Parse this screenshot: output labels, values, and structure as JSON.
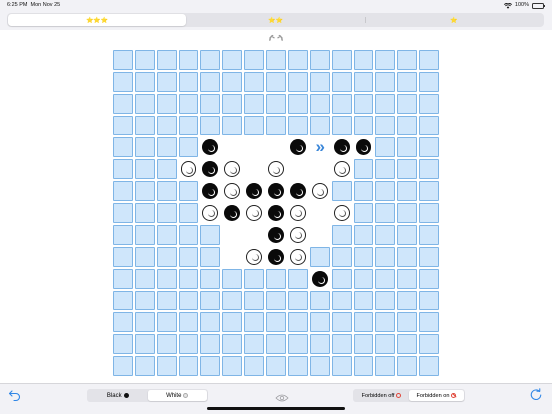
{
  "status_bar": {
    "time": "6:25 PM",
    "date": "Mon Nov 25",
    "battery": "100%",
    "icons": [
      "wifi-icon",
      "battery-icon"
    ]
  },
  "tabs": [
    {
      "label": "⭐⭐⭐",
      "active": true
    },
    {
      "label": "⭐⭐",
      "active": false
    },
    {
      "label": "⭐",
      "active": false
    }
  ],
  "laurel": "🕊🕊",
  "board": {
    "size": 15,
    "stones": [
      {
        "row": 4,
        "col": 4,
        "color": "black"
      },
      {
        "row": 4,
        "col": 8,
        "color": "black"
      },
      {
        "row": 4,
        "col": 10,
        "color": "black"
      },
      {
        "row": 4,
        "col": 11,
        "color": "black"
      },
      {
        "row": 5,
        "col": 3,
        "color": "white"
      },
      {
        "row": 5,
        "col": 4,
        "color": "black"
      },
      {
        "row": 5,
        "col": 5,
        "color": "white"
      },
      {
        "row": 5,
        "col": 7,
        "color": "white"
      },
      {
        "row": 5,
        "col": 10,
        "color": "white"
      },
      {
        "row": 6,
        "col": 4,
        "color": "black"
      },
      {
        "row": 6,
        "col": 5,
        "color": "white"
      },
      {
        "row": 6,
        "col": 6,
        "color": "black"
      },
      {
        "row": 6,
        "col": 7,
        "color": "black"
      },
      {
        "row": 6,
        "col": 8,
        "color": "black"
      },
      {
        "row": 6,
        "col": 9,
        "color": "white"
      },
      {
        "row": 7,
        "col": 4,
        "color": "white"
      },
      {
        "row": 7,
        "col": 5,
        "color": "black"
      },
      {
        "row": 7,
        "col": 6,
        "color": "white"
      },
      {
        "row": 7,
        "col": 7,
        "color": "black"
      },
      {
        "row": 7,
        "col": 8,
        "color": "white"
      },
      {
        "row": 7,
        "col": 10,
        "color": "white"
      },
      {
        "row": 8,
        "col": 7,
        "color": "black"
      },
      {
        "row": 8,
        "col": 8,
        "color": "white"
      },
      {
        "row": 9,
        "col": 6,
        "color": "white"
      },
      {
        "row": 9,
        "col": 7,
        "color": "black"
      },
      {
        "row": 9,
        "col": 8,
        "color": "white"
      },
      {
        "row": 10,
        "col": 9,
        "color": "black"
      }
    ],
    "played_empty": [
      {
        "row": 4,
        "col": 5
      },
      {
        "row": 4,
        "col": 6
      },
      {
        "row": 4,
        "col": 7
      },
      {
        "row": 5,
        "col": 6
      },
      {
        "row": 5,
        "col": 8
      },
      {
        "row": 5,
        "col": 9
      },
      {
        "row": 7,
        "col": 9
      },
      {
        "row": 8,
        "col": 5
      },
      {
        "row": 8,
        "col": 6
      },
      {
        "row": 8,
        "col": 9
      },
      {
        "row": 9,
        "col": 5
      }
    ],
    "hint_cells": [
      {
        "row": 4,
        "col": 9,
        "glyph": "»"
      }
    ],
    "colors": {
      "cell": "#cfe6fb",
      "cell_border": "#7fb5e6",
      "hint": "#3a86d8"
    }
  },
  "bottom_bar": {
    "player_options": [
      {
        "label": "Black",
        "stone": "black",
        "active": false
      },
      {
        "label": "White",
        "stone": "white",
        "active": true
      }
    ],
    "forbidden_options": [
      {
        "label": "Forbidden off",
        "icon": "circle-icon",
        "active": false
      },
      {
        "label": "Forbidden on",
        "icon": "prohibited-icon",
        "active": true
      }
    ]
  }
}
